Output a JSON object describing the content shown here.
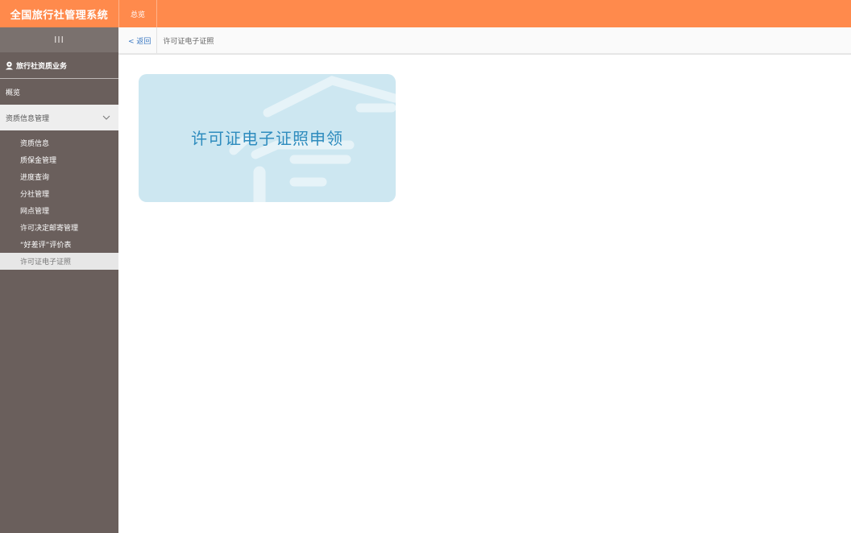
{
  "header": {
    "app_title": "全国旅行社管理系统",
    "nav_overview": "总览"
  },
  "sidebar": {
    "collapse_glyph": "III",
    "section_title": "旅行社资质业务",
    "section_icon": "user-badge-icon",
    "overview": "概览",
    "group_label": "资质信息管理",
    "group_icon": "chevron-down-icon",
    "items": [
      {
        "label": "资质信息"
      },
      {
        "label": "质保金管理"
      },
      {
        "label": "进度查询"
      },
      {
        "label": "分社管理"
      },
      {
        "label": "网点管理"
      },
      {
        "label": "许可决定邮寄管理"
      },
      {
        "label": "“好差评”评价表"
      },
      {
        "label": "许可证电子证照",
        "active": true
      }
    ]
  },
  "breadcrumb": {
    "back_label": "< 返回",
    "current": "许可证电子证照"
  },
  "main": {
    "card_title": "许可证电子证照申领"
  },
  "colors": {
    "header_orange": "#FF8A4C",
    "sidebar_brown": "#6A5F5C",
    "card_blue": "#CDE7F1",
    "card_text": "#2E8CBE",
    "link_blue": "#3A78C2"
  }
}
